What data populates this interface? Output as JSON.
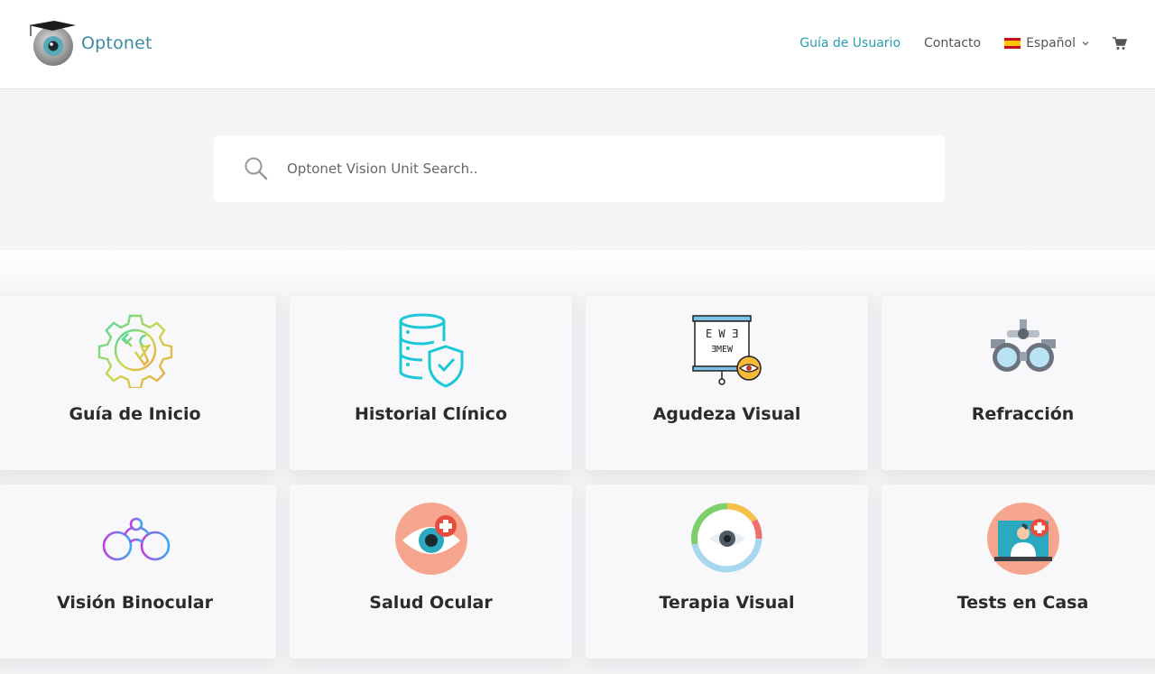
{
  "header": {
    "logo_text": "Optonet",
    "nav": {
      "guide": "Guía de Usuario",
      "contact": "Contacto",
      "language": "Español"
    }
  },
  "search": {
    "placeholder": "Optonet Vision Unit Search.."
  },
  "cards": [
    {
      "label": "Guía de Inicio",
      "icon": "gear-tools-icon"
    },
    {
      "label": "Historial Clínico",
      "icon": "database-shield-icon"
    },
    {
      "label": "Agudeza Visual",
      "icon": "eye-chart-icon"
    },
    {
      "label": "Refracción",
      "icon": "phoropter-icon"
    },
    {
      "label": "Visión Binocular",
      "icon": "binocular-glasses-icon"
    },
    {
      "label": "Salud Ocular",
      "icon": "eye-health-icon"
    },
    {
      "label": "Terapia Visual",
      "icon": "eye-therapy-icon"
    },
    {
      "label": "Tests en Casa",
      "icon": "doctor-screen-icon"
    }
  ],
  "colors": {
    "accent": "#2a9db0",
    "logo_text": "#3d8ba3",
    "background": "#f5f5f6"
  }
}
